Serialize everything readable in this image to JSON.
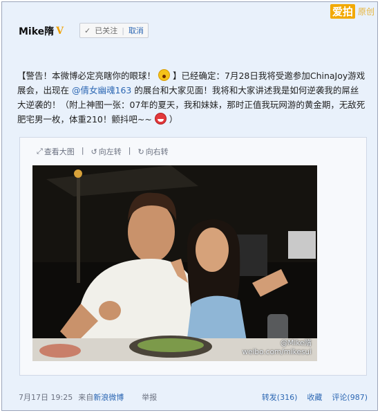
{
  "watermark": {
    "brand": "爱拍",
    "sub": "原创"
  },
  "user": {
    "name": "Mike隋",
    "verified_badge": "V"
  },
  "follow": {
    "status": "已关注",
    "cancel": "取消"
  },
  "post": {
    "part1": "【警告！本微博必定亮瞎你的眼球！",
    "part2": "】已经确定：7月28日我将受邀参加ChinaJoy游戏展会，出现在",
    "mention": "@倩女幽魂163",
    "part3": "的展台和大家见面！我将和大家讲述我是如何逆袭我的屌丝大逆袭的！（附上神图一张：07年的夏天，我和妹妹，那时正值我玩网游的黄金期，无敌死肥宅男一枚，体重210！颤抖吧~~",
    "part4": "）"
  },
  "photo_tools": {
    "view_large": "查看大图",
    "rotate_left": "向左转",
    "rotate_right": "向右转"
  },
  "photo": {
    "watermark_line1": "@Mike隋",
    "watermark_line2": "weibo.com/mikesui"
  },
  "footer": {
    "timestamp": "7月17日 19:25",
    "source_prefix": "来自",
    "source": "新浪微博",
    "report": "举报",
    "repost": "转发(316)",
    "favorite": "收藏",
    "comment": "评论(987)"
  },
  "colors": {
    "link": "#2c67b3",
    "badge": "#f0a000",
    "background": "#e9f1fb"
  }
}
